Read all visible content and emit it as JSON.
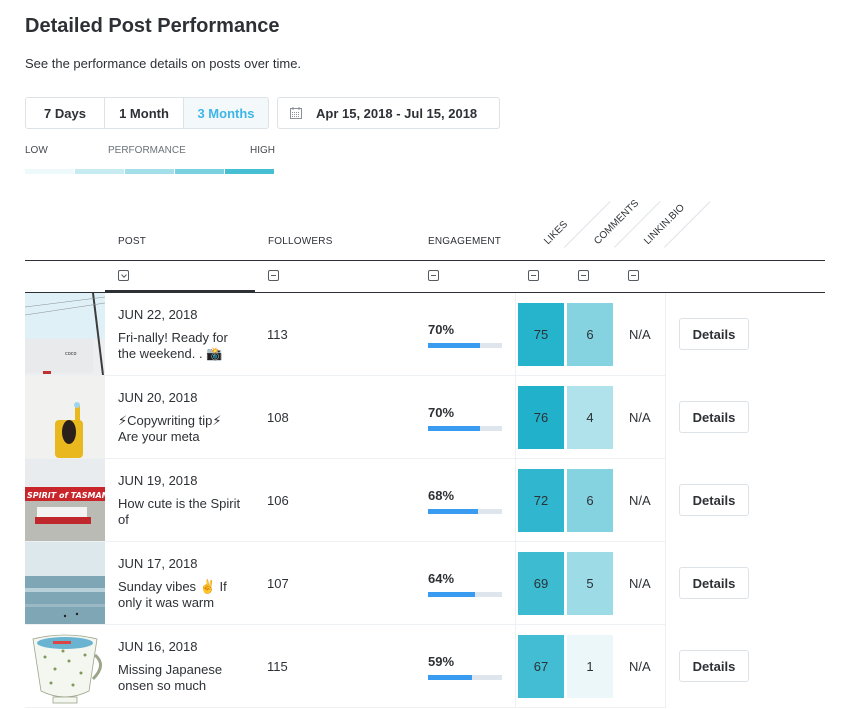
{
  "header": {
    "title": "Detailed Post Performance",
    "subtitle": "See the performance details on posts over time."
  },
  "range_selector": {
    "options": [
      {
        "label": "7 Days",
        "active": false
      },
      {
        "label": "1 Month",
        "active": false
      },
      {
        "label": "3 Months",
        "active": true
      }
    ],
    "date_range": "Apr 15, 2018 - Jul 15, 2018",
    "date_icon": "calendar-icon"
  },
  "legend": {
    "low": "LOW",
    "label": "PERFORMANCE",
    "high": "HIGH",
    "colors": [
      "#eef9fb",
      "#c6ebf1",
      "#a3dfe9",
      "#79d0de",
      "#45bfd1"
    ]
  },
  "table": {
    "columns": {
      "post": "POST",
      "followers": "FOLLOWERS",
      "engagement": "ENGAGEMENT",
      "likes": "LIKES",
      "comments": "COMMENTS",
      "linkin_bio": "LINKIN.BIO"
    },
    "sort_icons": {
      "post": "sort-desc-icon",
      "others": "sort-none-icon"
    },
    "details_label": "Details",
    "rows": [
      {
        "date": "JUN 22, 2018",
        "caption": "Fri-nally! Ready for the weekend. . 📸",
        "followers": "113",
        "engagement": "70%",
        "engagement_fraction": 0.7,
        "likes": "75",
        "comments": "6",
        "linkin_bio": "N/A",
        "likes_color": "#26b3cc",
        "comments_color": "#85d3e1",
        "thumb": "white-building-photo"
      },
      {
        "date": "JUN 20, 2018",
        "caption": "⚡Copywriting tip⚡ Are your meta",
        "followers": "108",
        "engagement": "70%",
        "engagement_fraction": 0.7,
        "likes": "76",
        "comments": "4",
        "linkin_bio": "N/A",
        "likes_color": "#22b1cb",
        "comments_color": "#b0e2eb",
        "thumb": "yellow-jacket-photo"
      },
      {
        "date": "JUN 19, 2018",
        "caption": "How cute is the Spirit of",
        "followers": "106",
        "engagement": "68%",
        "engagement_fraction": 0.68,
        "likes": "72",
        "comments": "6",
        "linkin_bio": "N/A",
        "likes_color": "#30b7cf",
        "comments_color": "#85d3e1",
        "thumb": "spirit-of-tasmania-photo"
      },
      {
        "date": "JUN 17, 2018",
        "caption": "Sunday vibes ✌️ If only it was warm",
        "followers": "107",
        "engagement": "64%",
        "engagement_fraction": 0.64,
        "likes": "69",
        "comments": "5",
        "linkin_bio": "N/A",
        "likes_color": "#3dbbd1",
        "comments_color": "#9ddbe6",
        "thumb": "ocean-surf-photo"
      },
      {
        "date": "JUN 16, 2018",
        "caption": "Missing Japanese onsen so much",
        "followers": "115",
        "engagement": "59%",
        "engagement_fraction": 0.59,
        "likes": "67",
        "comments": "1",
        "linkin_bio": "N/A",
        "likes_color": "#42bdd3",
        "comments_color": "#ebf7f9",
        "thumb": "teacup-illustration"
      }
    ]
  }
}
